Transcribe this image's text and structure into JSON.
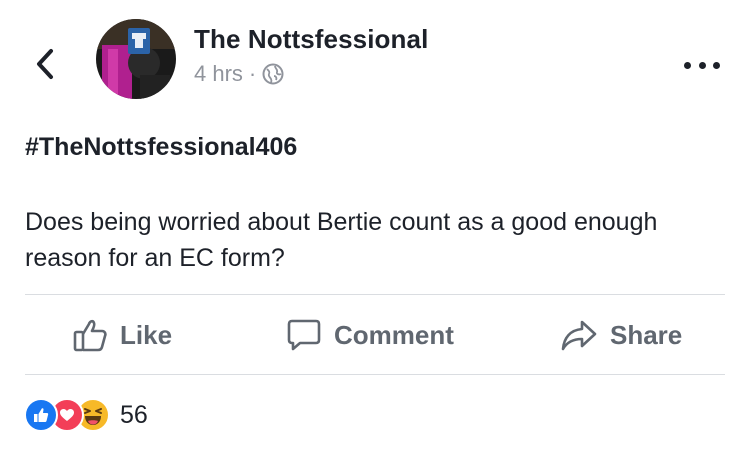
{
  "post": {
    "author": "The Nottsfessional",
    "time": "4 hrs",
    "separator": "·",
    "hashtag": "#TheNottsfessional406",
    "body": "Does being worried about Bertie count as a good enough reason for an EC form?"
  },
  "actions": {
    "like": "Like",
    "comment": "Comment",
    "share": "Share"
  },
  "reactions": {
    "types": [
      "like",
      "love",
      "haha"
    ],
    "count": "56"
  },
  "icons": {
    "back": "chevron-left-icon",
    "privacy": "globe-icon",
    "more": "more-dots-icon",
    "like": "thumbs-up-icon",
    "comment": "comment-bubble-icon",
    "share": "share-arrow-icon"
  },
  "colors": {
    "like_blue": "#1877f2",
    "love_red": "#f33e58",
    "haha_yellow": "#f7b928",
    "meta_gray": "#90949c",
    "action_gray": "#606770"
  }
}
